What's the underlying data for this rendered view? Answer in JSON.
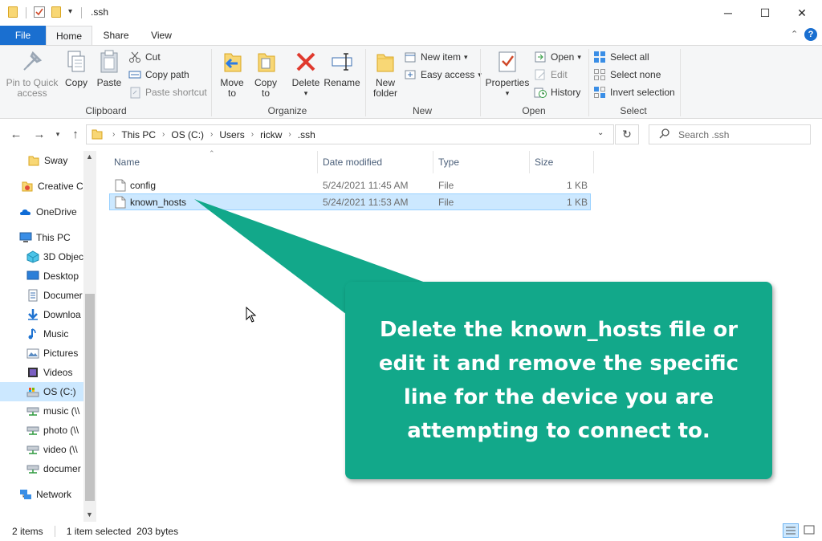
{
  "window": {
    "title": ".ssh",
    "minimize_glyph": "─",
    "maximize_glyph": "☐",
    "close_glyph": "✕"
  },
  "ribbon_tabs": [
    {
      "label": "File"
    },
    {
      "label": "Home"
    },
    {
      "label": "Share"
    },
    {
      "label": "View"
    }
  ],
  "ribbon": {
    "clipboard": {
      "label": "Clipboard",
      "pin": "Pin to Quick access",
      "pin_l1": "Pin to Quick",
      "pin_l2": "access",
      "copy": "Copy",
      "paste": "Paste",
      "cut": "Cut",
      "copy_path": "Copy path",
      "paste_shortcut": "Paste shortcut"
    },
    "organize": {
      "label": "Organize",
      "move_to": "Move",
      "move_to_2": "to",
      "copy_to": "Copy",
      "copy_to_2": "to",
      "delete": "Delete",
      "rename": "Rename"
    },
    "new": {
      "label": "New",
      "new_folder": "New",
      "new_folder_2": "folder",
      "new_item": "New item",
      "easy_access": "Easy access"
    },
    "open": {
      "label": "Open",
      "properties": "Properties",
      "open": "Open",
      "edit": "Edit",
      "history": "History"
    },
    "select": {
      "label": "Select",
      "select_all": "Select all",
      "select_none": "Select none",
      "invert_selection": "Invert selection"
    }
  },
  "address": {
    "crumbs": [
      "This PC",
      "OS (C:)",
      "Users",
      "rickw",
      ".ssh"
    ],
    "search_placeholder": "Search .ssh"
  },
  "nav_pane": [
    {
      "label": "Sway",
      "icon": "folder-icon"
    },
    {
      "label": "Creative Cl",
      "icon": "creative-cloud-icon"
    },
    {
      "label": "OneDrive",
      "icon": "cloud-icon"
    },
    {
      "label": "This PC",
      "icon": "computer-icon"
    },
    {
      "label": "3D Objec",
      "icon": "cube-icon"
    },
    {
      "label": "Desktop",
      "icon": "desktop-icon"
    },
    {
      "label": "Documer",
      "icon": "document-icon"
    },
    {
      "label": "Downloa",
      "icon": "download-icon"
    },
    {
      "label": "Music",
      "icon": "music-icon"
    },
    {
      "label": "Pictures",
      "icon": "pictures-icon"
    },
    {
      "label": "Videos",
      "icon": "video-icon"
    },
    {
      "label": "OS (C:)",
      "icon": "drive-icon"
    },
    {
      "label": "music (\\\\",
      "icon": "network-drive-icon"
    },
    {
      "label": "photo (\\\\",
      "icon": "network-drive-icon"
    },
    {
      "label": "video (\\\\",
      "icon": "network-drive-icon"
    },
    {
      "label": "documer",
      "icon": "network-drive-icon"
    },
    {
      "label": "Network",
      "icon": "network-icon"
    }
  ],
  "columns": {
    "name": "Name",
    "date": "Date modified",
    "type": "Type",
    "size": "Size"
  },
  "files": [
    {
      "name": "config",
      "date": "5/24/2021 11:45 AM",
      "type": "File",
      "size": "1 KB"
    },
    {
      "name": "known_hosts",
      "date": "5/24/2021 11:53 AM",
      "type": "File",
      "size": "1 KB"
    }
  ],
  "status": {
    "items": "2 items",
    "selected": "1 item selected  203 bytes"
  },
  "callout": {
    "text": "Delete the known_hosts file or edit it and remove the specific line for the device you are attempting to connect to."
  },
  "colors": {
    "accent": "#1a6fd0",
    "selection": "#cce8ff",
    "callout": "#12a88a"
  }
}
